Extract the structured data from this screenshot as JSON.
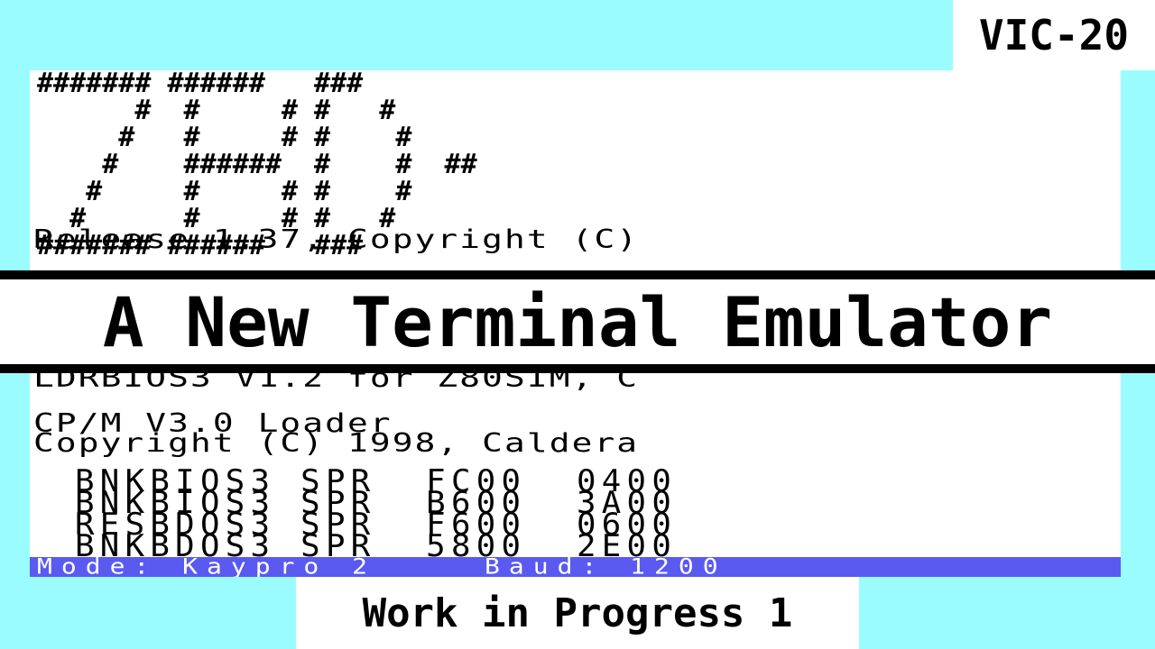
{
  "badge": "VIC-20",
  "banner": [
    "####### ######   ###",
    "      #  #     # #   #",
    "     #   #     # #    #",
    "    #    ######  #    #  ##",
    "   #     #     # #    #",
    "  #      #     # #   #",
    "####### ######   ###"
  ],
  "terminal": {
    "release": "Release 1.37, Copyright (C)",
    "ldrbios": "LDRBIOS3 V1.2 for Z80SIM, C",
    "cpm_loader": "CP/M V3.0 Loader",
    "copyright": "Copyright (C) 1998, Caldera",
    "files": [
      {
        "name": "BNKBIOS3",
        "type": "SPR",
        "addr": "FC00",
        "size": "0400"
      },
      {
        "name": "BNKBIOS3",
        "type": "SPR",
        "addr": "B600",
        "size": "3A00"
      },
      {
        "name": "RESBDOS3",
        "type": "SPR",
        "addr": "F600",
        "size": "0600"
      },
      {
        "name": "BNKBDOS3",
        "type": "SPR",
        "addr": "5800",
        "size": "2E00"
      }
    ],
    "status_mode": "Mode: Kaypro 2",
    "status_baud": "Baud: 1200"
  },
  "title": "A New Terminal Emulator",
  "subtitle": "Work in Progress 1",
  "colors": {
    "background": "#9bfcff",
    "screen": "#ffffff",
    "status_bar": "#5a5af0",
    "title_border": "#000000"
  }
}
